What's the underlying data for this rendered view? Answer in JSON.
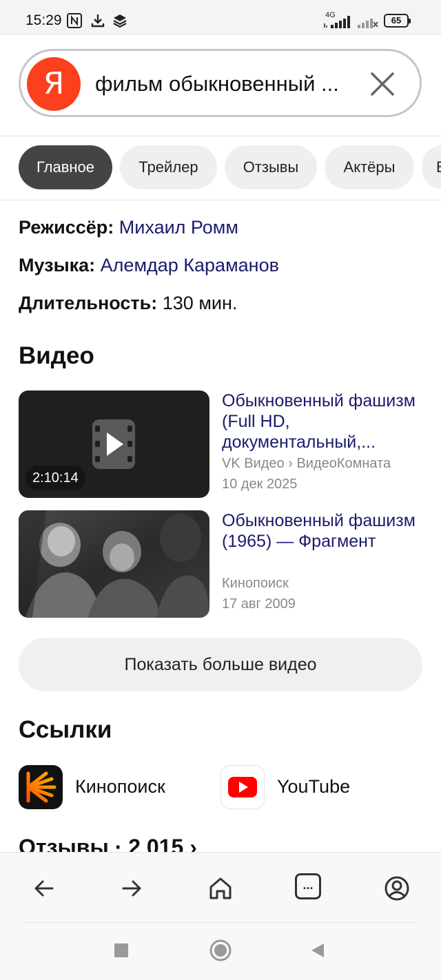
{
  "status_bar": {
    "time": "15:29",
    "network": "4G",
    "battery": "65"
  },
  "search": {
    "logo_letter": "Я",
    "query": "фильм обыкновенный ..."
  },
  "tabs": [
    {
      "label": "Главное",
      "active": true
    },
    {
      "label": "Трейлер",
      "active": false
    },
    {
      "label": "Отзывы",
      "active": false
    },
    {
      "label": "Актёры",
      "active": false
    },
    {
      "label": "В",
      "active": false
    }
  ],
  "info": {
    "director_label": "Режиссёр:",
    "director_value": "Михаил Ромм",
    "music_label": "Музыка:",
    "music_value": "Алемдар Караманов",
    "duration_label": "Длительность:",
    "duration_value": "130 мин."
  },
  "videos": {
    "heading": "Видео",
    "items": [
      {
        "title": "Обыкновенный фашизм (Full HD, документальный,...",
        "source": "VK Видео › ВидеоКомната",
        "date": "10 дек 2025",
        "duration": "2:10:14"
      },
      {
        "title": "Обыкновенный фашизм (1965) — Фрагмент",
        "source": "Кинопоиск",
        "date": "17 авг 2009"
      }
    ],
    "more_label": "Показать больше видео"
  },
  "links": {
    "heading": "Ссылки",
    "items": [
      {
        "label": "Кинопоиск",
        "icon": "kinopoisk-icon"
      },
      {
        "label": "YouTube",
        "icon": "youtube-icon"
      }
    ]
  },
  "reviews": {
    "heading": "Отзывы · 2 015 ›"
  },
  "toolbar": {
    "tabs_label": "..."
  },
  "colors": {
    "accent_link": "#1b1b6b",
    "yandex_red": "#fc3f1d",
    "active_tab": "#444444",
    "youtube_red": "#ff0000"
  }
}
